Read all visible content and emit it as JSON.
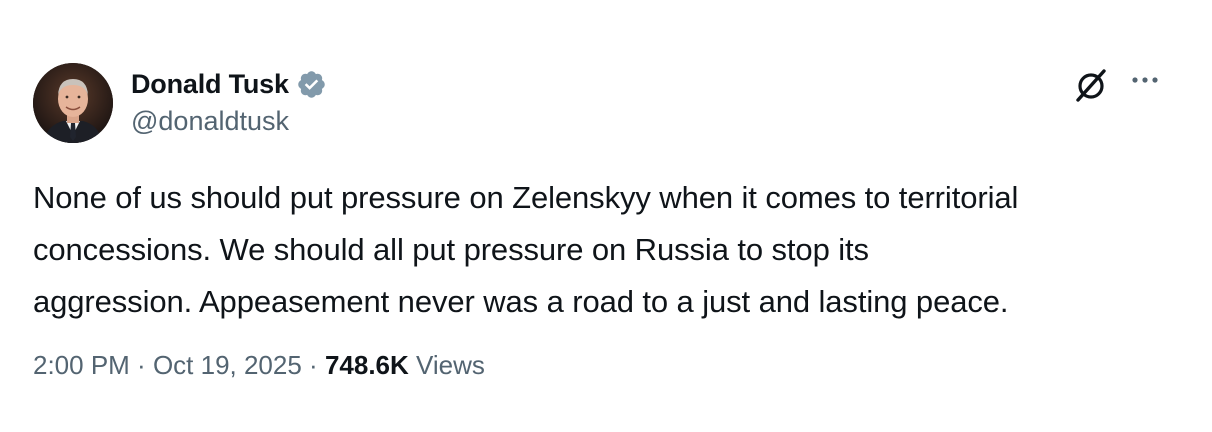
{
  "author": {
    "display_name": "Donald Tusk",
    "handle": "@donaldtusk",
    "verified": true,
    "verified_color": "#829aab",
    "avatar_icon": "profile-photo"
  },
  "tweet": {
    "text": "None of us should put pressure on Zelenskyy when it comes to territorial\nconcessions. We should all put pressure on Russia to stop its\naggression. Appeasement never was a road to a just and lasting peace."
  },
  "meta": {
    "time": "2:00 PM",
    "separator": " · ",
    "date": "Oct 19, 2025",
    "views_count": "748.6K",
    "views_label": " Views"
  },
  "actions": {
    "grok_icon": "grok-icon",
    "more_icon": "more-options-icon"
  },
  "colors": {
    "text_primary": "#0f1419",
    "text_secondary": "#536471",
    "background": "#ffffff"
  }
}
